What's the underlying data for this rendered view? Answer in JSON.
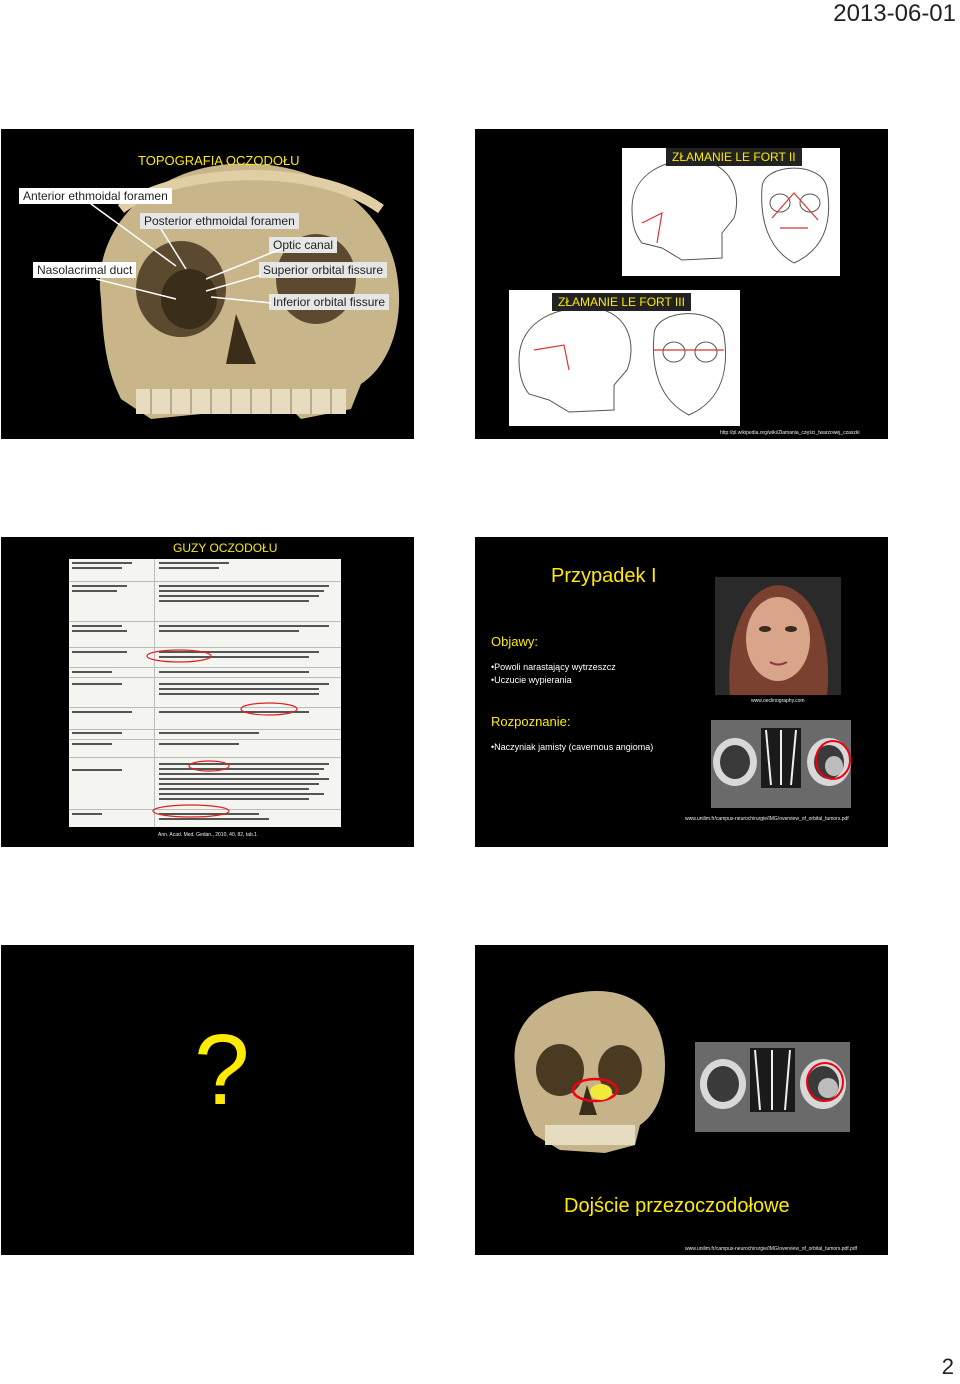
{
  "page": {
    "date": "2013-06-01",
    "number": "2"
  },
  "slide1": {
    "title": "TOPOGRAFIA OCZODOŁU",
    "labels": {
      "anterior": "Anterior ethmoidal foramen",
      "posterior": "Posterior ethmoidal foramen",
      "optic": "Optic canal",
      "nasolacrimal": "Nasolacrimal duct",
      "superior": "Superior orbital fissure",
      "inferior": "Inferior orbital fissure"
    }
  },
  "slide2": {
    "title_fort2": "ZŁAMANIE LE FORT II",
    "title_fort3": "ZŁAMANIE LE FORT III",
    "source": "http://pl.wikipedia.org/wiki/Złamania_części_twarzowej_czaszki"
  },
  "slide3": {
    "title": "GUZY OCZODOŁU",
    "source": "Ann. Acad. Med. Gedan., 2010, 40, 82, tab.1"
  },
  "slide4": {
    "title": "Przypadek I",
    "symptoms_heading": "Objawy:",
    "symptoms": [
      "•Powoli narastający wytrzeszcz",
      "•Uczucie wypierania"
    ],
    "diagnosis_heading": "Rozpoznanie:",
    "diagnosis": [
      "•Naczyniak jamisty (cavernous angioma)"
    ],
    "photo_source": "www.oeclinography.com",
    "ct_source": "www.unilim.fr/campus-neurochirurgie/IMG/overview_of_orbital_tumors.pdf"
  },
  "slide5": {
    "symbol": "?"
  },
  "slide6": {
    "title": "Dojście przezoczodołowe",
    "source": "www.unilim.fr/campus-neurochirurgie/IMG/overview_of_orbital_tumors.pdf.pdf"
  }
}
